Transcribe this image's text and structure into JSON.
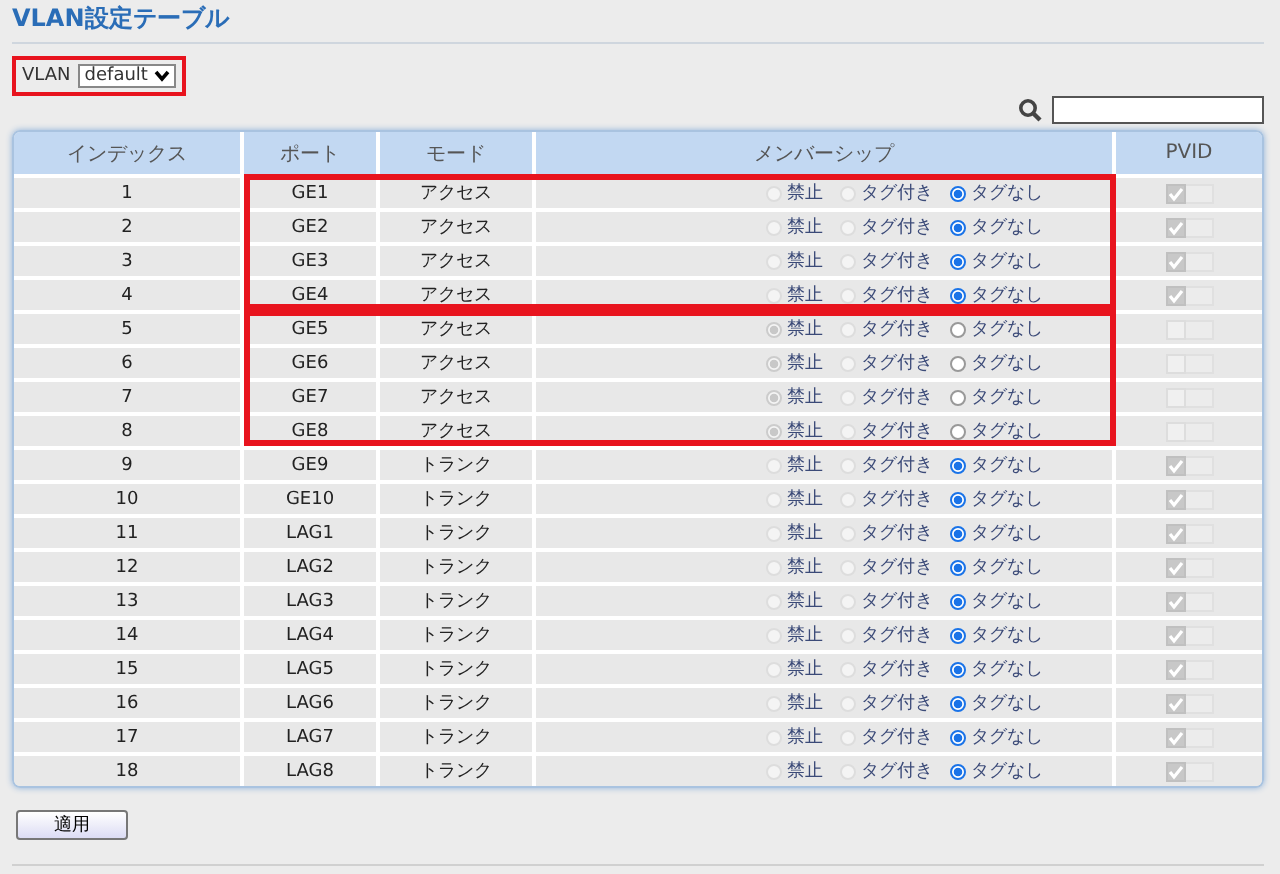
{
  "title": "VLAN設定テーブル",
  "vlan_selector": {
    "label": "VLAN",
    "value": "default",
    "highlighted": true
  },
  "table": {
    "columns": [
      "インデックス",
      "ポート",
      "モード",
      "メンバーシップ",
      "PVID"
    ],
    "rows": [
      {
        "index": "1",
        "port": "GE1",
        "mode": "アクセス",
        "highlighted": true,
        "highlight_start": true,
        "pvid": true,
        "options": [
          {
            "label": "禁止",
            "selected": false,
            "disabled": true
          },
          {
            "label": "タグ付き",
            "selected": false,
            "disabled": true
          },
          {
            "label": "タグなし",
            "selected": true,
            "disabled": false
          }
        ]
      },
      {
        "index": "2",
        "port": "GE2",
        "mode": "アクセス",
        "highlighted": true,
        "highlight_start": false,
        "pvid": true,
        "options": [
          {
            "label": "禁止",
            "selected": false,
            "disabled": true
          },
          {
            "label": "タグ付き",
            "selected": false,
            "disabled": true
          },
          {
            "label": "タグなし",
            "selected": true,
            "disabled": false
          }
        ]
      },
      {
        "index": "3",
        "port": "GE3",
        "mode": "アクセス",
        "highlighted": true,
        "highlight_start": false,
        "pvid": true,
        "options": [
          {
            "label": "禁止",
            "selected": false,
            "disabled": true
          },
          {
            "label": "タグ付き",
            "selected": false,
            "disabled": true
          },
          {
            "label": "タグなし",
            "selected": true,
            "disabled": false
          }
        ]
      },
      {
        "index": "4",
        "port": "GE4",
        "mode": "アクセス",
        "highlighted": true,
        "highlight_start": false,
        "pvid": true,
        "options": [
          {
            "label": "禁止",
            "selected": false,
            "disabled": true
          },
          {
            "label": "タグ付き",
            "selected": false,
            "disabled": true
          },
          {
            "label": "タグなし",
            "selected": true,
            "disabled": false
          }
        ]
      },
      {
        "index": "5",
        "port": "GE5",
        "mode": "アクセス",
        "highlighted": true,
        "highlight_start": true,
        "pvid": false,
        "options": [
          {
            "label": "禁止",
            "selected": true,
            "disabled": true
          },
          {
            "label": "タグ付き",
            "selected": false,
            "disabled": true
          },
          {
            "label": "タグなし",
            "selected": false,
            "disabled": false
          }
        ]
      },
      {
        "index": "6",
        "port": "GE6",
        "mode": "アクセス",
        "highlighted": true,
        "highlight_start": false,
        "pvid": false,
        "options": [
          {
            "label": "禁止",
            "selected": true,
            "disabled": true
          },
          {
            "label": "タグ付き",
            "selected": false,
            "disabled": true
          },
          {
            "label": "タグなし",
            "selected": false,
            "disabled": false
          }
        ]
      },
      {
        "index": "7",
        "port": "GE7",
        "mode": "アクセス",
        "highlighted": true,
        "highlight_start": false,
        "pvid": false,
        "options": [
          {
            "label": "禁止",
            "selected": true,
            "disabled": true
          },
          {
            "label": "タグ付き",
            "selected": false,
            "disabled": true
          },
          {
            "label": "タグなし",
            "selected": false,
            "disabled": false
          }
        ]
      },
      {
        "index": "8",
        "port": "GE8",
        "mode": "アクセス",
        "highlighted": true,
        "highlight_start": false,
        "pvid": false,
        "options": [
          {
            "label": "禁止",
            "selected": true,
            "disabled": true
          },
          {
            "label": "タグ付き",
            "selected": false,
            "disabled": true
          },
          {
            "label": "タグなし",
            "selected": false,
            "disabled": false
          }
        ]
      },
      {
        "index": "9",
        "port": "GE9",
        "mode": "トランク",
        "highlighted": false,
        "pvid": true,
        "options": [
          {
            "label": "禁止",
            "selected": false,
            "disabled": true
          },
          {
            "label": "タグ付き",
            "selected": false,
            "disabled": true
          },
          {
            "label": "タグなし",
            "selected": true,
            "disabled": false
          }
        ]
      },
      {
        "index": "10",
        "port": "GE10",
        "mode": "トランク",
        "highlighted": false,
        "pvid": true,
        "options": [
          {
            "label": "禁止",
            "selected": false,
            "disabled": true
          },
          {
            "label": "タグ付き",
            "selected": false,
            "disabled": true
          },
          {
            "label": "タグなし",
            "selected": true,
            "disabled": false
          }
        ]
      },
      {
        "index": "11",
        "port": "LAG1",
        "mode": "トランク",
        "highlighted": false,
        "pvid": true,
        "options": [
          {
            "label": "禁止",
            "selected": false,
            "disabled": true
          },
          {
            "label": "タグ付き",
            "selected": false,
            "disabled": true
          },
          {
            "label": "タグなし",
            "selected": true,
            "disabled": false
          }
        ]
      },
      {
        "index": "12",
        "port": "LAG2",
        "mode": "トランク",
        "highlighted": false,
        "pvid": true,
        "options": [
          {
            "label": "禁止",
            "selected": false,
            "disabled": true
          },
          {
            "label": "タグ付き",
            "selected": false,
            "disabled": true
          },
          {
            "label": "タグなし",
            "selected": true,
            "disabled": false
          }
        ]
      },
      {
        "index": "13",
        "port": "LAG3",
        "mode": "トランク",
        "highlighted": false,
        "pvid": true,
        "options": [
          {
            "label": "禁止",
            "selected": false,
            "disabled": true
          },
          {
            "label": "タグ付き",
            "selected": false,
            "disabled": true
          },
          {
            "label": "タグなし",
            "selected": true,
            "disabled": false
          }
        ]
      },
      {
        "index": "14",
        "port": "LAG4",
        "mode": "トランク",
        "highlighted": false,
        "pvid": true,
        "options": [
          {
            "label": "禁止",
            "selected": false,
            "disabled": true
          },
          {
            "label": "タグ付き",
            "selected": false,
            "disabled": true
          },
          {
            "label": "タグなし",
            "selected": true,
            "disabled": false
          }
        ]
      },
      {
        "index": "15",
        "port": "LAG5",
        "mode": "トランク",
        "highlighted": false,
        "pvid": true,
        "options": [
          {
            "label": "禁止",
            "selected": false,
            "disabled": true
          },
          {
            "label": "タグ付き",
            "selected": false,
            "disabled": true
          },
          {
            "label": "タグなし",
            "selected": true,
            "disabled": false
          }
        ]
      },
      {
        "index": "16",
        "port": "LAG6",
        "mode": "トランク",
        "highlighted": false,
        "pvid": true,
        "options": [
          {
            "label": "禁止",
            "selected": false,
            "disabled": true
          },
          {
            "label": "タグ付き",
            "selected": false,
            "disabled": true
          },
          {
            "label": "タグなし",
            "selected": true,
            "disabled": false
          }
        ]
      },
      {
        "index": "17",
        "port": "LAG7",
        "mode": "トランク",
        "highlighted": false,
        "pvid": true,
        "options": [
          {
            "label": "禁止",
            "selected": false,
            "disabled": true
          },
          {
            "label": "タグ付き",
            "selected": false,
            "disabled": true
          },
          {
            "label": "タグなし",
            "selected": true,
            "disabled": false
          }
        ]
      },
      {
        "index": "18",
        "port": "LAG8",
        "mode": "トランク",
        "highlighted": false,
        "pvid": true,
        "options": [
          {
            "label": "禁止",
            "selected": false,
            "disabled": true
          },
          {
            "label": "タグ付き",
            "selected": false,
            "disabled": true
          },
          {
            "label": "タグなし",
            "selected": true,
            "disabled": false
          }
        ]
      }
    ]
  },
  "apply_button": "適用"
}
